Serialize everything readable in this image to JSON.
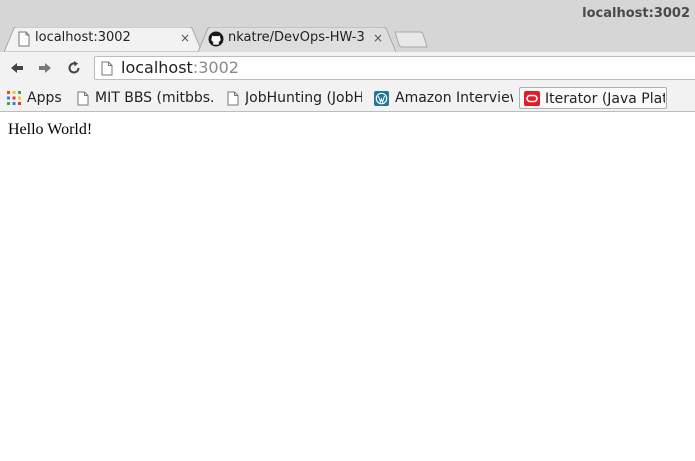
{
  "window": {
    "title": "localhost:3002"
  },
  "tabs": [
    {
      "label": "localhost:3002",
      "icon": "page-icon",
      "close": "×"
    },
    {
      "label": "nkatre/DevOps-HW-3",
      "icon": "github-icon",
      "close": "×"
    }
  ],
  "toolbar": {
    "url_host": "localhost",
    "url_port": ":3002"
  },
  "bookmarks": [
    {
      "label": "Apps",
      "icon": "apps-grid-icon"
    },
    {
      "label": "MIT BBS (mitbbs.c",
      "icon": "page-icon"
    },
    {
      "label": "JobHunting (JobHu",
      "icon": "page-icon"
    },
    {
      "label": "Amazon Interview",
      "icon": "wordpress-icon"
    },
    {
      "label": "Iterator (Java Platf",
      "icon": "oracle-icon"
    }
  ],
  "content": {
    "text": "Hello World!"
  },
  "colors": {
    "chrome_bg": "#d6d6d6",
    "toolbar_bg": "#f2f2f2",
    "oracle_red": "#e51b24",
    "wordpress_blue": "#21759b"
  }
}
